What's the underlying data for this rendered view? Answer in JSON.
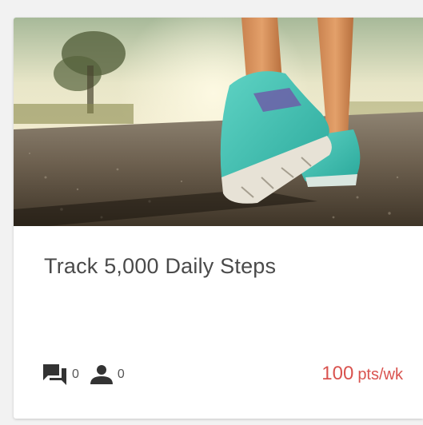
{
  "card": {
    "title": "Track 5,000 Daily Steps",
    "hero_image": "running-shoes-photo",
    "comments": {
      "icon": "comments-icon",
      "count": "0"
    },
    "participants": {
      "icon": "person-icon",
      "count": "0"
    },
    "points": {
      "value": "100",
      "unit": "pts/wk"
    }
  },
  "colors": {
    "points_accent": "#d9534f",
    "title_text": "#4a4a4a",
    "page_background": "#f2f2f2"
  }
}
